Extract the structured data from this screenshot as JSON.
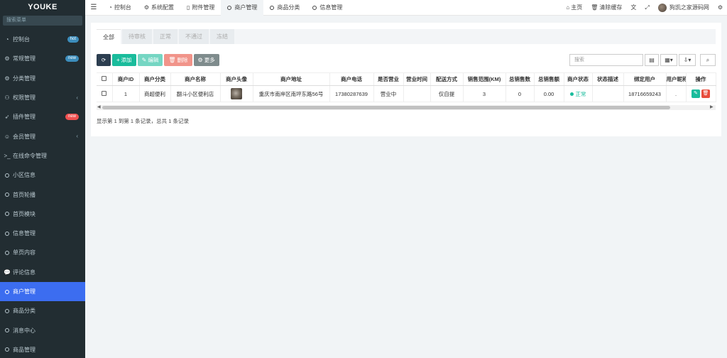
{
  "app": {
    "logo": "YOUKE"
  },
  "sidebar": {
    "search_placeholder": "搜索菜单",
    "items": [
      {
        "label": "控制台",
        "badge": "hot"
      },
      {
        "label": "常规管理",
        "badge": "new"
      },
      {
        "label": "分类管理"
      },
      {
        "label": "权限管理"
      },
      {
        "label": "插件管理",
        "badge": "new"
      },
      {
        "label": "会员管理"
      },
      {
        "label": "在线命令管理"
      },
      {
        "label": "小区信息"
      },
      {
        "label": "首页轮播"
      },
      {
        "label": "首页模块"
      },
      {
        "label": "信息管理"
      },
      {
        "label": "单页内容"
      },
      {
        "label": "评论信息"
      },
      {
        "label": "商户管理"
      },
      {
        "label": "商品分类"
      },
      {
        "label": "消息中心"
      },
      {
        "label": "商品管理"
      }
    ]
  },
  "topbar": {
    "tabs": [
      {
        "label": "控制台"
      },
      {
        "label": "系统配置"
      },
      {
        "label": "附件管理"
      },
      {
        "label": "商户管理"
      },
      {
        "label": "商品分类"
      },
      {
        "label": "信息管理"
      }
    ],
    "home": "主页",
    "clear_cache": "清除缓存",
    "user": "狗凯之家源码网"
  },
  "filter_tabs": [
    "全部",
    "待审核",
    "正常",
    "不通过",
    "冻结"
  ],
  "toolbar": {
    "add": "添加",
    "edit": "编辑",
    "delete": "删除",
    "more": "更多",
    "search_placeholder": "搜索"
  },
  "table": {
    "headers": [
      "商户ID",
      "商户分类",
      "商户名称",
      "商户头像",
      "商户地址",
      "商户电话",
      "是否营业",
      "营业时间",
      "配送方式",
      "销售范围(KM)",
      "总销售数",
      "总销售额",
      "商户状态",
      "状态描述",
      "绑定用户",
      "用户昵称",
      "操作"
    ],
    "rows": [
      {
        "id": "1",
        "category": "商超便利",
        "name": "翻斗小区便利店",
        "address": "重庆市南岸区南坪东路56号",
        "phone": "17380287639",
        "open": "营业中",
        "hours": "",
        "delivery": "仅自提",
        "range": "3",
        "total_count": "0",
        "total_amount": "0.00",
        "status": "正常",
        "status_desc": "",
        "bound_user": "18716659243",
        "nickname": "."
      }
    ]
  },
  "pager_text": "显示第 1 到第 1 条记录，总共 1 条记录"
}
